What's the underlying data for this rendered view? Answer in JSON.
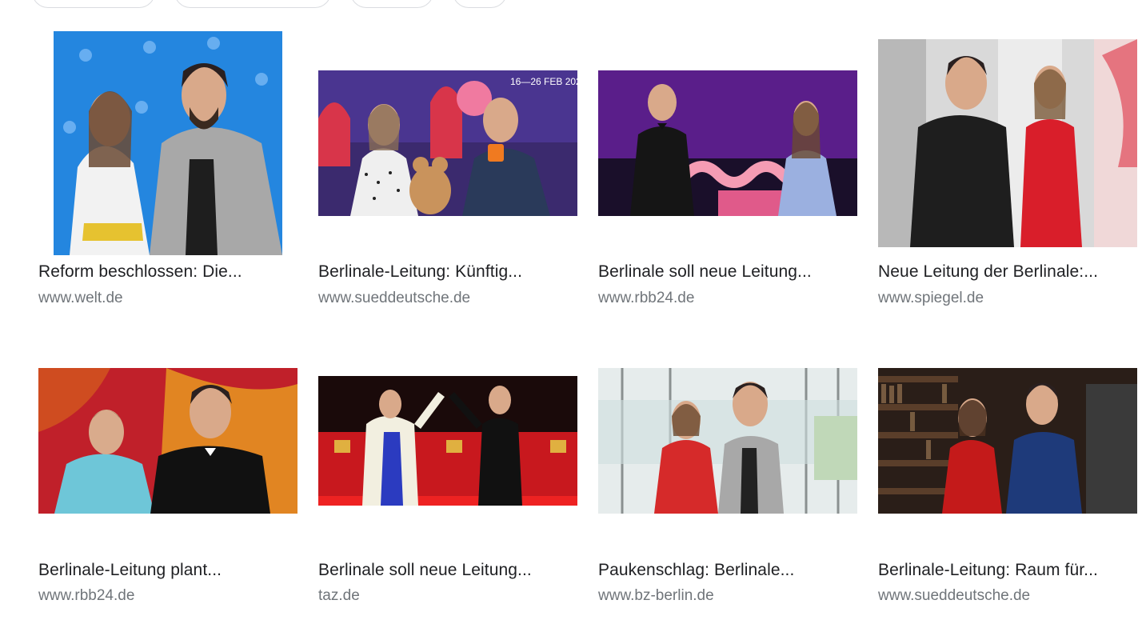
{
  "filter_chips": [
    "",
    "",
    "",
    ""
  ],
  "results": [
    {
      "title": "Reform beschlossen: Die...",
      "source": "www.welt.de",
      "image_alt": "Two people at Berlinale press wall"
    },
    {
      "title": "Berlinale-Leitung: Künftig...",
      "source": "www.sueddeutsche.de",
      "image_alt": "Two people with teddy bear and mug"
    },
    {
      "title": "Berlinale soll neue Leitung...",
      "source": "www.rbb24.de",
      "image_alt": "Two hosts on stage"
    },
    {
      "title": "Neue Leitung der Berlinale:...",
      "source": "www.spiegel.de",
      "image_alt": "Two people standing indoors"
    },
    {
      "title": "Berlinale-Leitung plant...",
      "source": "www.rbb24.de",
      "image_alt": "Two people on stage, warm background"
    },
    {
      "title": "Berlinale soll neue Leitung...",
      "source": "taz.de",
      "image_alt": "Two people on red carpet"
    },
    {
      "title": "Paukenschlag: Berlinale...",
      "source": "www.bz-berlin.de",
      "image_alt": "Two people by a window"
    },
    {
      "title": "Berlinale-Leitung: Raum für...",
      "source": "www.sueddeutsche.de",
      "image_alt": "Two people in front of bookshelves"
    }
  ]
}
